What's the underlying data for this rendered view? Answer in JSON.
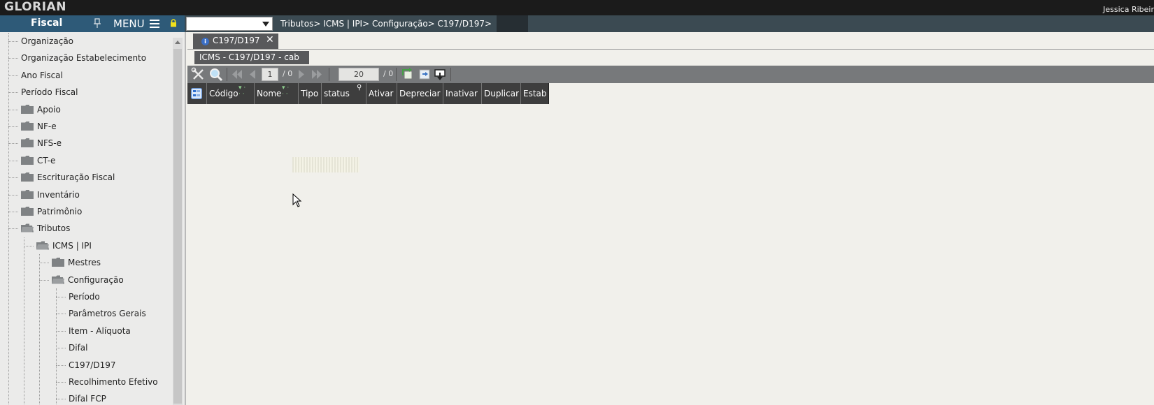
{
  "app": {
    "logo_text": "GLORIAN",
    "user_name": "Jessica Ribeir",
    "accent_color": "#2e5a78",
    "navbar_color": "#3b4a52"
  },
  "sidebar": {
    "title": "Fiscal",
    "menu_label": "MENU",
    "icons": {
      "pin": "pin-icon",
      "menu": "hamburger-icon",
      "lock": "lock-icon"
    },
    "items": [
      {
        "label": "Organização",
        "type": "leaf"
      },
      {
        "label": "Organização Estabelecimento",
        "type": "leaf"
      },
      {
        "label": "Ano Fiscal",
        "type": "leaf"
      },
      {
        "label": "Período Fiscal",
        "type": "leaf"
      },
      {
        "label": "Apoio",
        "type": "folder"
      },
      {
        "label": "NF-e",
        "type": "folder"
      },
      {
        "label": "NFS-e",
        "type": "folder"
      },
      {
        "label": "CT-e",
        "type": "folder"
      },
      {
        "label": "Escrituração Fiscal",
        "type": "folder"
      },
      {
        "label": "Inventário",
        "type": "folder"
      },
      {
        "label": "Patrimônio",
        "type": "folder"
      },
      {
        "label": "Tributos",
        "type": "folder-open"
      },
      {
        "label": "ICMS | IPI",
        "type": "folder-open"
      },
      {
        "label": "Mestres",
        "type": "folder"
      },
      {
        "label": "Configuração",
        "type": "folder-open"
      },
      {
        "label": "Período",
        "type": "leaf"
      },
      {
        "label": "Parâmetros Gerais",
        "type": "leaf"
      },
      {
        "label": "Item - Alíquota",
        "type": "leaf"
      },
      {
        "label": "Difal",
        "type": "leaf"
      },
      {
        "label": "C197/D197",
        "type": "leaf"
      },
      {
        "label": "Recolhimento Efetivo",
        "type": "leaf"
      },
      {
        "label": "Difal FCP",
        "type": "leaf"
      }
    ]
  },
  "navbar": {
    "select_value": "",
    "breadcrumb": "Tributos> ICMS | IPI> Configuração> C197/D197>"
  },
  "tab": {
    "label": "C197/D197",
    "close": "✕",
    "icon": "info-icon"
  },
  "subtab": {
    "label": "ICMS - C197/D197 - cab"
  },
  "toolbar": {
    "page_current": "1",
    "page_total": "/ 0",
    "page_size": "20",
    "records_total": "/ 0",
    "icons": [
      "tools-icon",
      "search-icon",
      "first-page-icon",
      "prev-page-icon",
      "next-page-icon",
      "last-page-icon",
      "refresh-icon",
      "export-icon",
      "download-icon"
    ]
  },
  "grid": {
    "columns": [
      "Código",
      "Nome",
      "Tipo",
      "status",
      "Ativar",
      "Depreciar",
      "Inativar",
      "Duplicar",
      "Estab"
    ]
  }
}
